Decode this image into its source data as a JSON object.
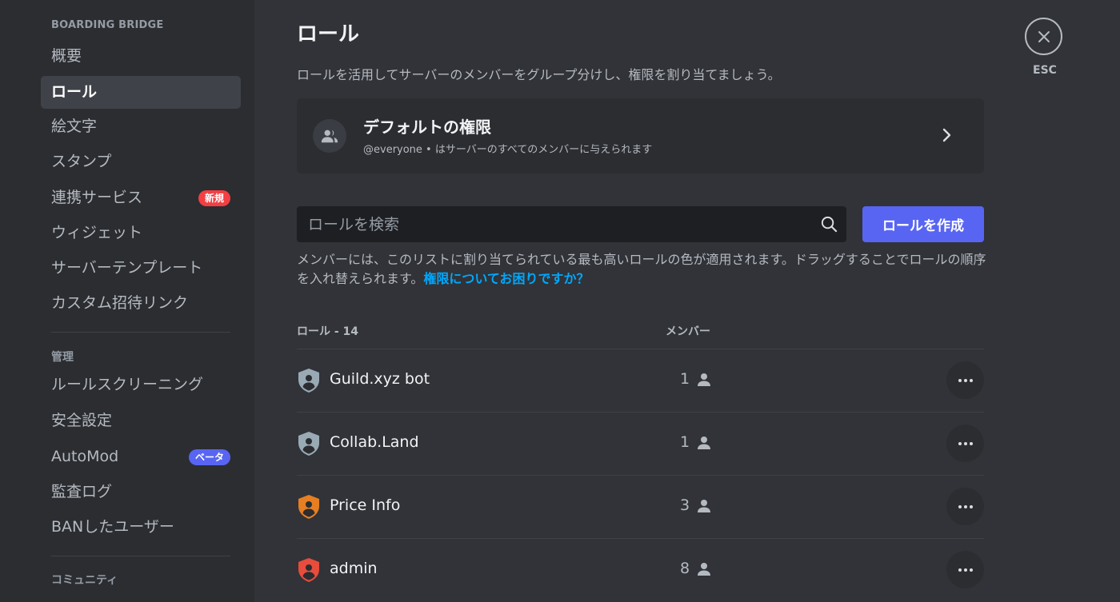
{
  "sidebar": {
    "server_name": "BOARDING BRIDGE",
    "items": [
      {
        "label": "概要"
      },
      {
        "label": "ロール"
      },
      {
        "label": "絵文字"
      },
      {
        "label": "スタンプ"
      },
      {
        "label": "連携サービス",
        "badge": "新規"
      },
      {
        "label": "ウィジェット"
      },
      {
        "label": "サーバーテンプレート"
      },
      {
        "label": "カスタム招待リンク"
      }
    ],
    "moderation_section": "管理",
    "moderation_items": [
      {
        "label": "ルールスクリーニング"
      },
      {
        "label": "安全設定"
      },
      {
        "label": "AutoMod",
        "badge": "ベータ"
      },
      {
        "label": "監査ログ"
      },
      {
        "label": "BANしたユーザー"
      }
    ],
    "community_section": "コミュニティ"
  },
  "header": {
    "title": "ロール",
    "description": "ロールを活用してサーバーのメンバーをグループ分けし、権限を割り当てましょう。"
  },
  "default_permissions": {
    "title": "デフォルトの権限",
    "subtitle": "@everyone • はサーバーのすべてのメンバーに与えられます"
  },
  "search": {
    "placeholder": "ロールを検索",
    "value": ""
  },
  "create_button": "ロールを作成",
  "help": {
    "text": "メンバーには、このリストに割り当てられている最も高いロールの色が適用されます。ドラッグすることでロールの順序を入れ替えられます。",
    "link": "権限についてお困りですか？"
  },
  "table": {
    "col_roles": "ロール - 14",
    "col_members": "メンバー",
    "rows": [
      {
        "name": "Guild.xyz bot",
        "members": "1",
        "color": "#99aab5"
      },
      {
        "name": "Collab.Land",
        "members": "1",
        "color": "#99aab5"
      },
      {
        "name": "Price Info",
        "members": "3",
        "color": "#e67e22"
      },
      {
        "name": "admin",
        "members": "8",
        "color": "#e74c3c"
      }
    ]
  },
  "close": {
    "label": "ESC"
  },
  "icons": {
    "default_avatar": "people-icon",
    "chevron": "chevron-right-icon",
    "search": "search-icon",
    "role": "shield-icon",
    "member": "person-icon",
    "more": "more-horizontal-icon",
    "close": "close-icon"
  }
}
